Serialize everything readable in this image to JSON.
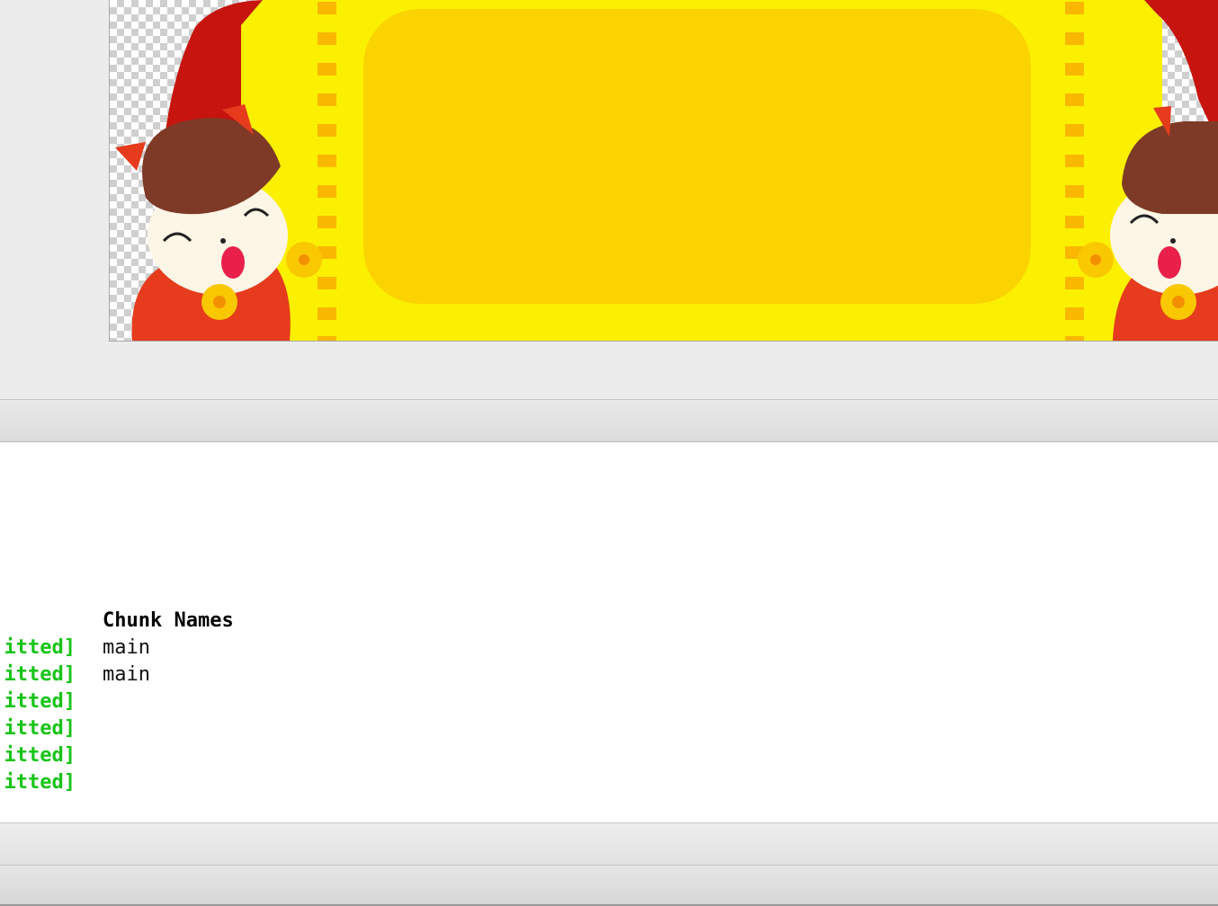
{
  "console": {
    "header": "Chunk Names",
    "rows": [
      {
        "status": "itted]",
        "chunk": "main"
      },
      {
        "status": "itted]",
        "chunk": "main"
      },
      {
        "status": "itted]",
        "chunk": ""
      },
      {
        "status": "itted]",
        "chunk": ""
      },
      {
        "status": "itted]",
        "chunk": ""
      },
      {
        "status": "itted]",
        "chunk": ""
      }
    ]
  },
  "colors": {
    "emitted_green": "#18c418",
    "banner_yellow": "#fbf000",
    "panel_gold": "#fbd300",
    "dash_orange": "#f9b700",
    "character_red": "#e63b1d"
  }
}
